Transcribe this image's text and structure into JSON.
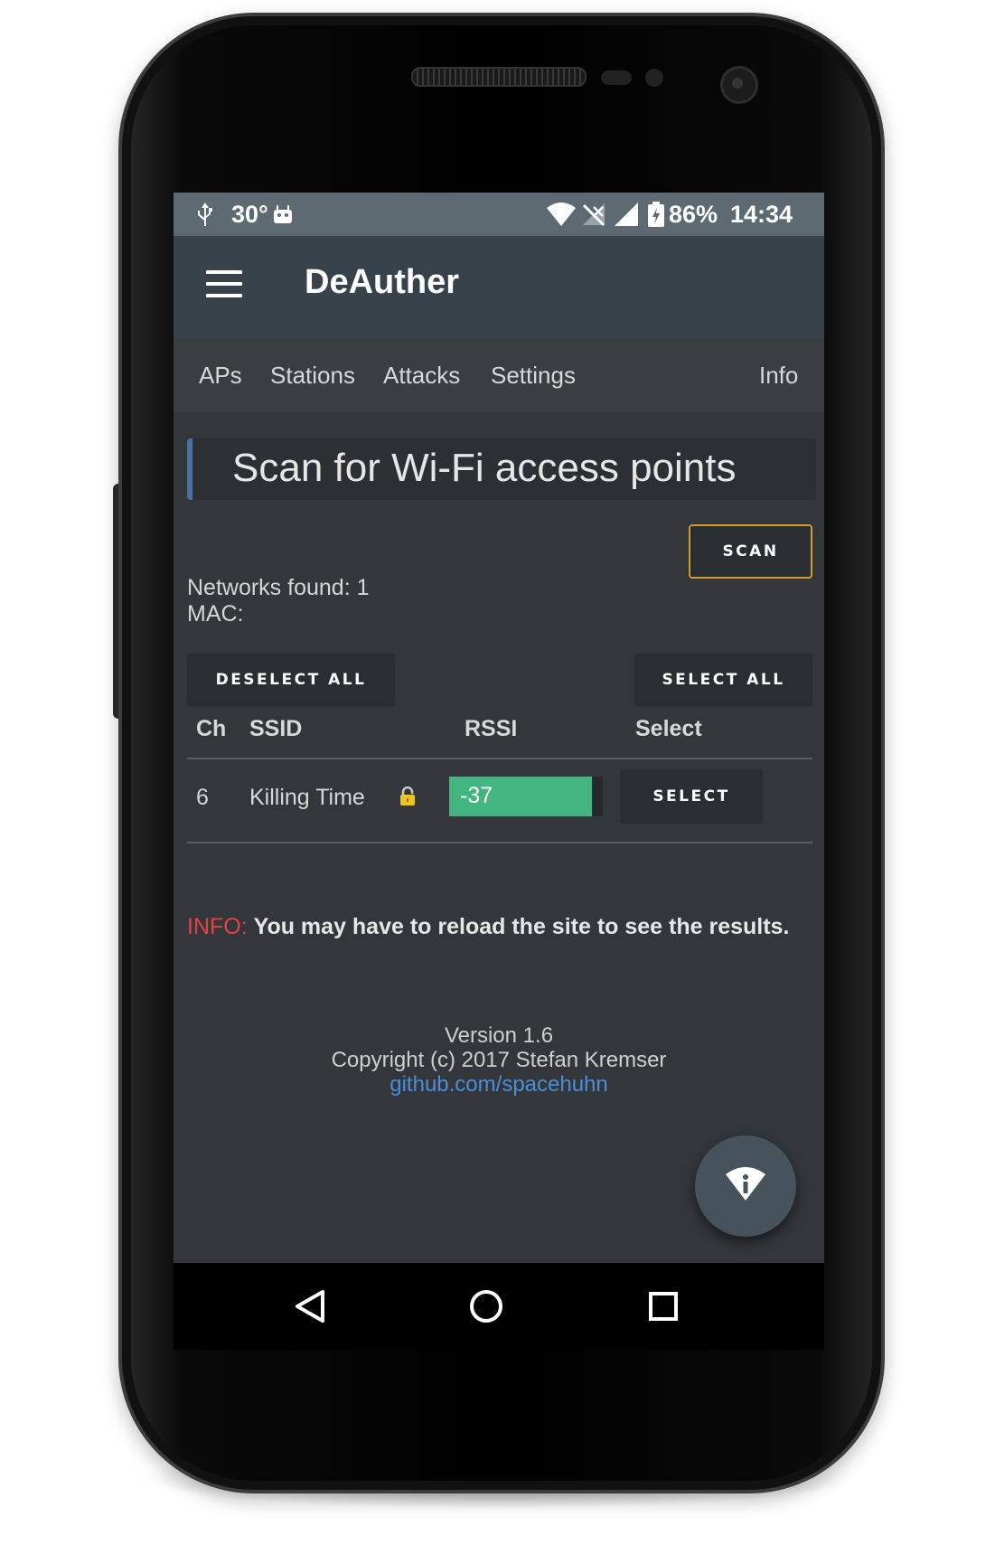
{
  "status_bar": {
    "temperature": "30°",
    "battery_percent": "86%",
    "time": "14:34",
    "icons": [
      "usb-icon",
      "android-icon",
      "wifi-icon",
      "no-signal-icon",
      "cell-signal-icon",
      "battery-charging-icon"
    ]
  },
  "app_bar": {
    "title": "DeAuther",
    "menu_icon": "hamburger-menu-icon"
  },
  "tabs": [
    {
      "label": "APs"
    },
    {
      "label": "Stations"
    },
    {
      "label": "Attacks"
    },
    {
      "label": "Settings"
    },
    {
      "label": "Info"
    }
  ],
  "main": {
    "heading": "Scan for Wi-Fi access points",
    "scan_button": "SCAN",
    "networks_found": "Networks found: 1",
    "mac": "MAC:",
    "deselect_all_button": "DESELECT ALL",
    "select_all_button": "SELECT ALL",
    "table": {
      "headers": [
        "Ch",
        "SSID",
        "RSSI",
        "Select"
      ],
      "rows": [
        {
          "ch": "6",
          "ssid": "Killing Time",
          "locked": true,
          "rssi": "-37",
          "rssi_fill_fraction": 0.93,
          "select_label": "SELECT"
        }
      ]
    },
    "info": {
      "label": "INFO:",
      "message": "You may have to reload the site to see the results."
    }
  },
  "footer": {
    "version": "Version 1.6",
    "copyright": "Copyright (c) 2017 Stefan Kremser",
    "link": "github.com/spacehuhn"
  },
  "fab": {
    "icon": "wifi-info-icon"
  },
  "nav_bar": {
    "icons": [
      "back-icon",
      "home-icon",
      "recents-icon"
    ]
  },
  "colors": {
    "accent_border": "#d49b2a",
    "heading_bar": "#4a6fa5",
    "rssi_fill": "#43b581",
    "info_label": "#e04545",
    "link": "#4a8fd8",
    "app_bar": "#37424a",
    "status_bar": "#5e6a72",
    "background": "#33363b"
  }
}
